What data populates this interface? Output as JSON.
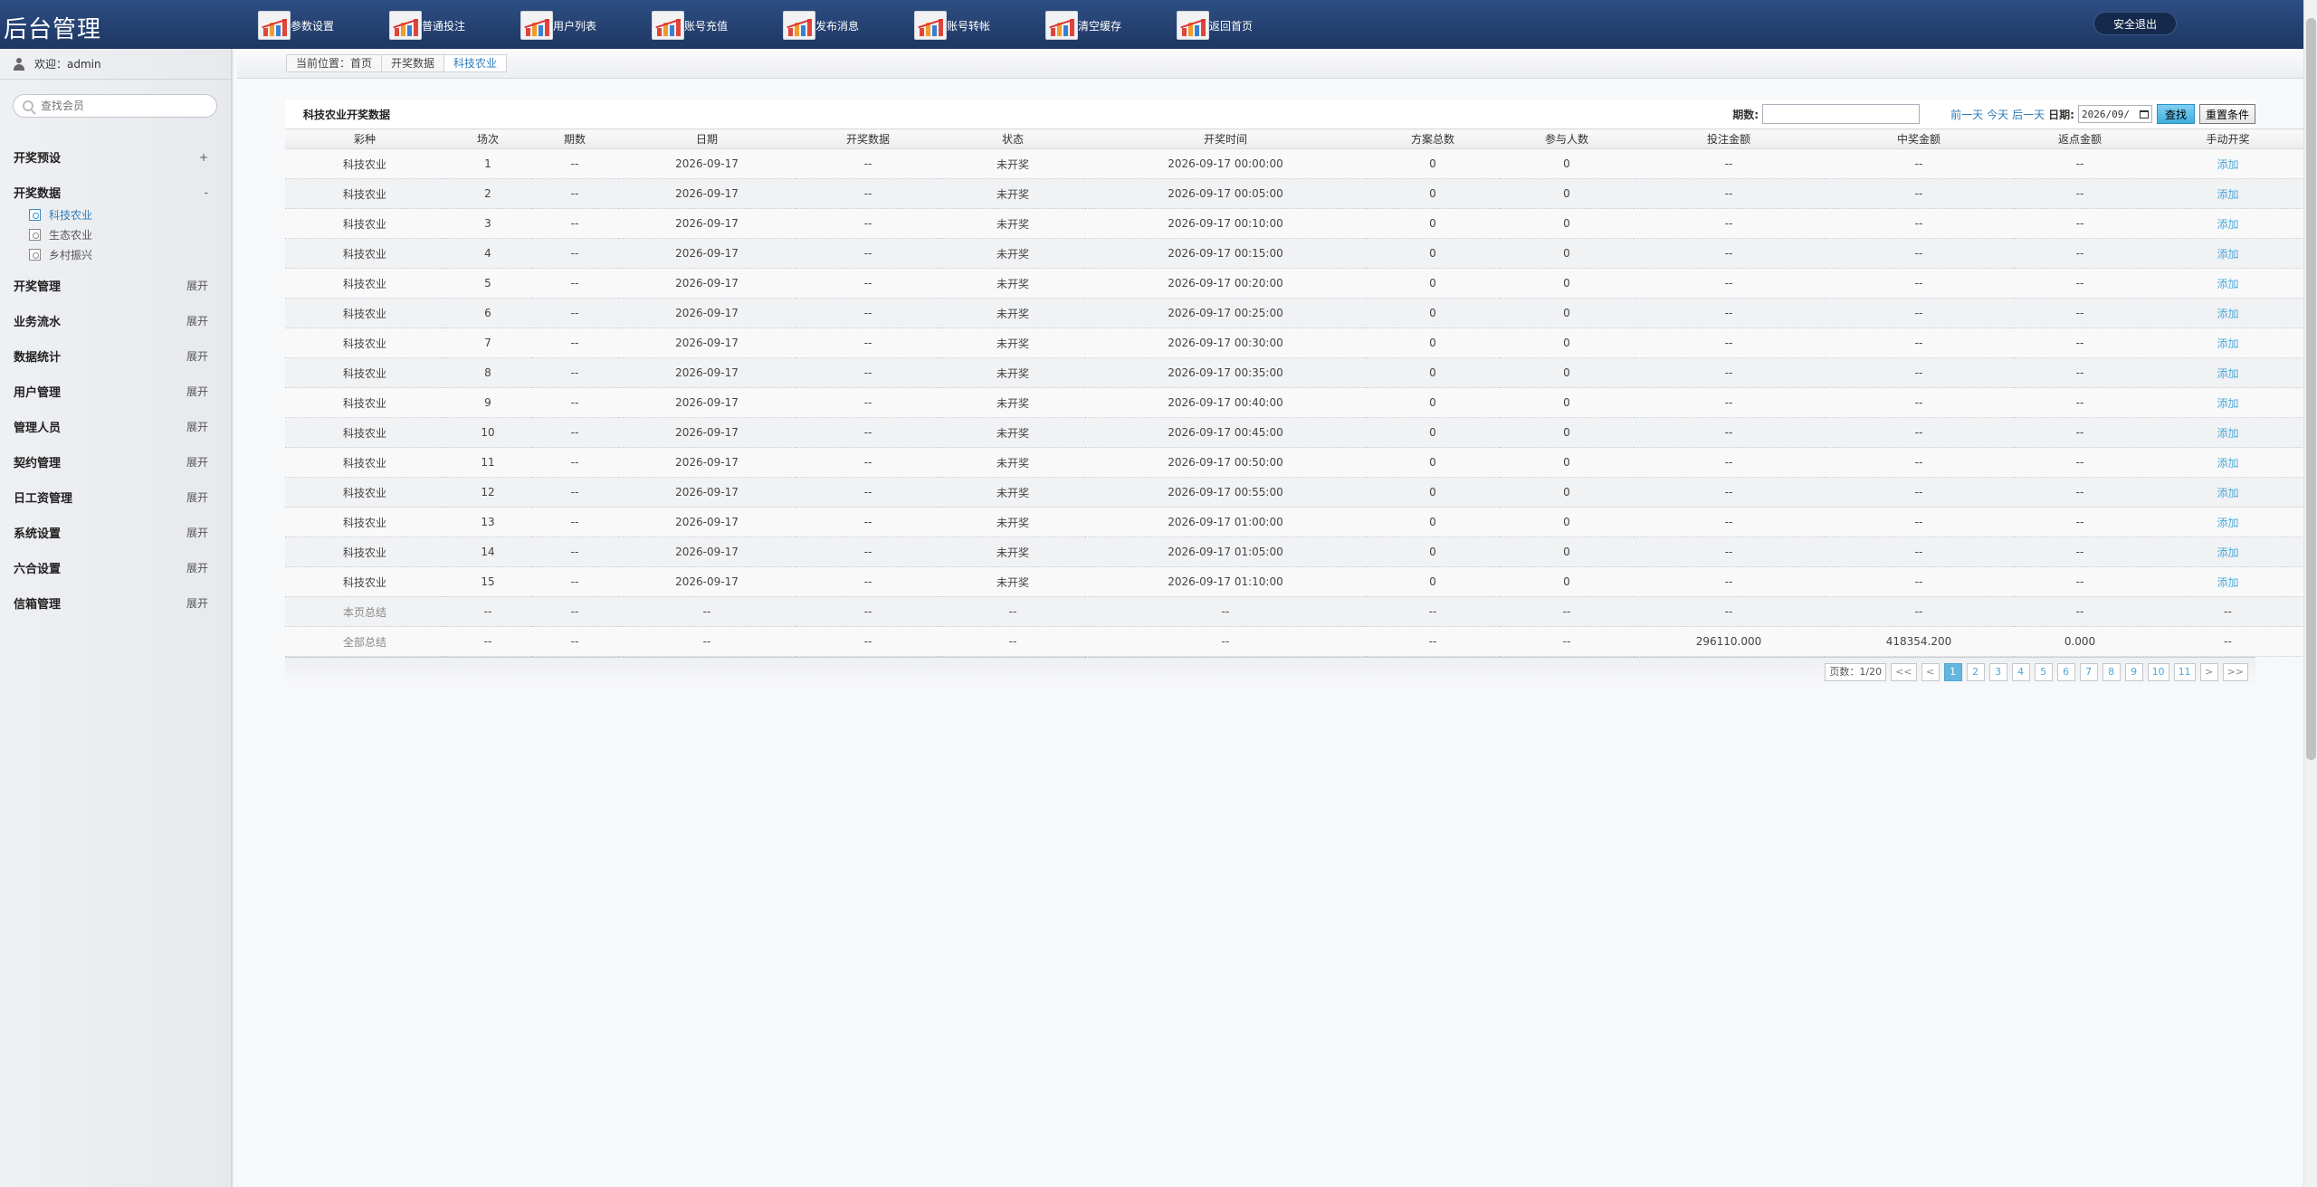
{
  "app": {
    "title": "后台管理",
    "logout_label": "安全退出"
  },
  "topnav": [
    {
      "label": "参数设置",
      "icon": "chart-icon"
    },
    {
      "label": "普通投注",
      "icon": "chart-icon"
    },
    {
      "label": "用户列表",
      "icon": "chart-icon"
    },
    {
      "label": "账号充值",
      "icon": "chart-icon"
    },
    {
      "label": "发布消息",
      "icon": "chart-icon"
    },
    {
      "label": "账号转帐",
      "icon": "chart-icon"
    },
    {
      "label": "清空缓存",
      "icon": "chart-icon"
    },
    {
      "label": "返回首页",
      "icon": "chart-icon"
    }
  ],
  "sidebar": {
    "welcome": "欢迎：admin",
    "search_placeholder": "查找会员",
    "menu": [
      {
        "label": "开奖预设",
        "toggle": "+"
      },
      {
        "label": "开奖数据",
        "toggle": "-"
      },
      {
        "label": "开奖管理",
        "toggle": "展开"
      },
      {
        "label": "业务流水",
        "toggle": "展开"
      },
      {
        "label": "数据统计",
        "toggle": "展开"
      },
      {
        "label": "用户管理",
        "toggle": "展开"
      },
      {
        "label": "管理人员",
        "toggle": "展开"
      },
      {
        "label": "契约管理",
        "toggle": "展开"
      },
      {
        "label": "日工资管理",
        "toggle": "展开"
      },
      {
        "label": "系统设置",
        "toggle": "展开"
      },
      {
        "label": "六合设置",
        "toggle": "展开"
      },
      {
        "label": "信箱管理",
        "toggle": "展开"
      }
    ],
    "submenu": [
      "科技农业",
      "生态农业",
      "乡村振兴"
    ]
  },
  "breadcrumb": [
    "当前位置：首页",
    "开奖数据",
    "科技农业"
  ],
  "panel": {
    "title": "科技农业开奖数据",
    "period_label": "期数:",
    "prev_day": "前一天",
    "today": "今天",
    "next_day": "后一天",
    "date_label": "日期:",
    "date_value": "2026/09/",
    "find_label": "查找",
    "reset_label": "重置条件"
  },
  "table": {
    "columns": [
      "彩种",
      "场次",
      "期数",
      "日期",
      "开奖数据",
      "状态",
      "开奖时间",
      "方案总数",
      "参与人数",
      "投注金额",
      "中奖金额",
      "返点金额",
      "手动开奖"
    ],
    "rows": [
      [
        "科技农业",
        "1",
        "--",
        "2026-09-17",
        "--",
        "未开奖",
        "2026-09-17 00:00:00",
        "0",
        "0",
        "--",
        "--",
        "--",
        "添加"
      ],
      [
        "科技农业",
        "2",
        "--",
        "2026-09-17",
        "--",
        "未开奖",
        "2026-09-17 00:05:00",
        "0",
        "0",
        "--",
        "--",
        "--",
        "添加"
      ],
      [
        "科技农业",
        "3",
        "--",
        "2026-09-17",
        "--",
        "未开奖",
        "2026-09-17 00:10:00",
        "0",
        "0",
        "--",
        "--",
        "--",
        "添加"
      ],
      [
        "科技农业",
        "4",
        "--",
        "2026-09-17",
        "--",
        "未开奖",
        "2026-09-17 00:15:00",
        "0",
        "0",
        "--",
        "--",
        "--",
        "添加"
      ],
      [
        "科技农业",
        "5",
        "--",
        "2026-09-17",
        "--",
        "未开奖",
        "2026-09-17 00:20:00",
        "0",
        "0",
        "--",
        "--",
        "--",
        "添加"
      ],
      [
        "科技农业",
        "6",
        "--",
        "2026-09-17",
        "--",
        "未开奖",
        "2026-09-17 00:25:00",
        "0",
        "0",
        "--",
        "--",
        "--",
        "添加"
      ],
      [
        "科技农业",
        "7",
        "--",
        "2026-09-17",
        "--",
        "未开奖",
        "2026-09-17 00:30:00",
        "0",
        "0",
        "--",
        "--",
        "--",
        "添加"
      ],
      [
        "科技农业",
        "8",
        "--",
        "2026-09-17",
        "--",
        "未开奖",
        "2026-09-17 00:35:00",
        "0",
        "0",
        "--",
        "--",
        "--",
        "添加"
      ],
      [
        "科技农业",
        "9",
        "--",
        "2026-09-17",
        "--",
        "未开奖",
        "2026-09-17 00:40:00",
        "0",
        "0",
        "--",
        "--",
        "--",
        "添加"
      ],
      [
        "科技农业",
        "10",
        "--",
        "2026-09-17",
        "--",
        "未开奖",
        "2026-09-17 00:45:00",
        "0",
        "0",
        "--",
        "--",
        "--",
        "添加"
      ],
      [
        "科技农业",
        "11",
        "--",
        "2026-09-17",
        "--",
        "未开奖",
        "2026-09-17 00:50:00",
        "0",
        "0",
        "--",
        "--",
        "--",
        "添加"
      ],
      [
        "科技农业",
        "12",
        "--",
        "2026-09-17",
        "--",
        "未开奖",
        "2026-09-17 00:55:00",
        "0",
        "0",
        "--",
        "--",
        "--",
        "添加"
      ],
      [
        "科技农业",
        "13",
        "--",
        "2026-09-17",
        "--",
        "未开奖",
        "2026-09-17 01:00:00",
        "0",
        "0",
        "--",
        "--",
        "--",
        "添加"
      ],
      [
        "科技农业",
        "14",
        "--",
        "2026-09-17",
        "--",
        "未开奖",
        "2026-09-17 01:05:00",
        "0",
        "0",
        "--",
        "--",
        "--",
        "添加"
      ],
      [
        "科技农业",
        "15",
        "--",
        "2026-09-17",
        "--",
        "未开奖",
        "2026-09-17 01:10:00",
        "0",
        "0",
        "--",
        "--",
        "--",
        "添加"
      ]
    ],
    "summary_rows": [
      [
        "本页总结",
        "--",
        "--",
        "--",
        "--",
        "--",
        "--",
        "--",
        "--",
        "--",
        "--",
        "--",
        "--"
      ],
      [
        "全部总结",
        "--",
        "--",
        "--",
        "--",
        "--",
        "--",
        "--",
        "--",
        "296110.000",
        "418354.200",
        "0.000",
        "--"
      ]
    ]
  },
  "pager": {
    "info": "页数：1/20",
    "first": "<<",
    "prev": "<",
    "pages": [
      "1",
      "2",
      "3",
      "4",
      "5",
      "6",
      "7",
      "8",
      "9",
      "10",
      "11"
    ],
    "current": "1",
    "next": ">",
    "last": ">>"
  }
}
